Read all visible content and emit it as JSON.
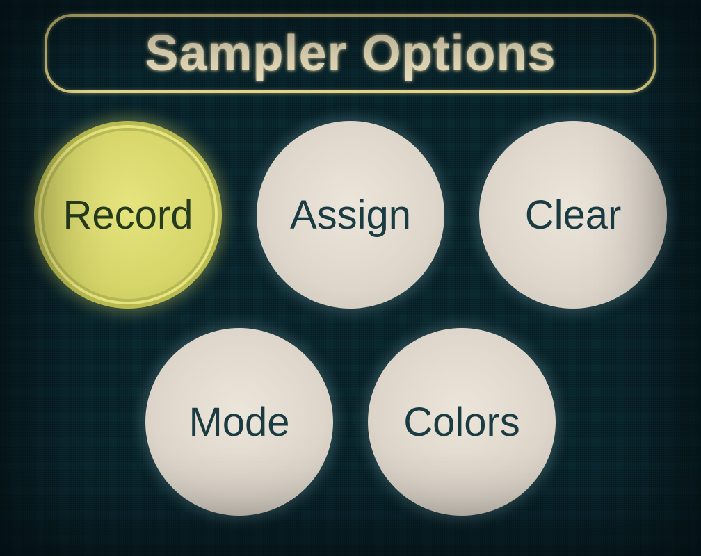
{
  "title": "Sampler Options",
  "buttons": {
    "row1": [
      {
        "label": "Record",
        "active": true
      },
      {
        "label": "Assign",
        "active": false
      },
      {
        "label": "Clear",
        "active": false
      }
    ],
    "row2": [
      {
        "label": "Mode",
        "active": false
      },
      {
        "label": "Colors",
        "active": false
      }
    ]
  }
}
